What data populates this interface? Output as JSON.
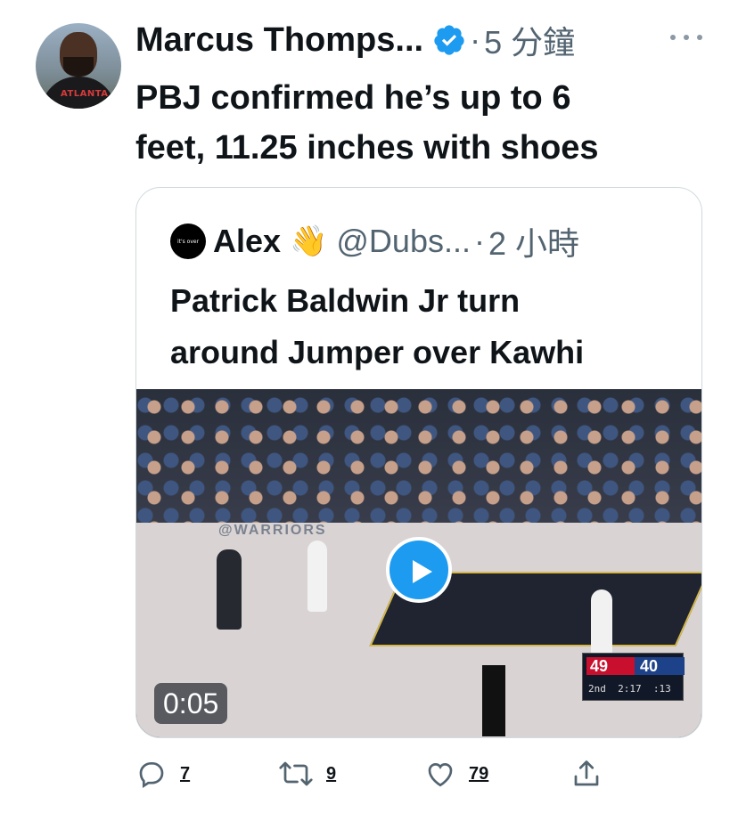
{
  "tweet": {
    "author_name": "Marcus Thomps...",
    "time": "5 分鐘",
    "separator": "·",
    "text_line1": "PBJ confirmed he’s up to 6",
    "text_line2": "feet, 11.25 inches with shoes",
    "avatar_shirt_text": "ATLANTA"
  },
  "quote": {
    "avatar_text": "it's over",
    "name": "Alex",
    "emoji": "👋",
    "handle": "@Dubs...",
    "separator": "·",
    "time": "2 小時",
    "text_line1": "Patrick Baldwin Jr turn",
    "text_line2": "around Jumper over Kawhi",
    "video": {
      "duration": "0:05",
      "scoreboard": {
        "left_score": "49",
        "right_score": "40",
        "quarter": "2nd",
        "clock": "2:17",
        "shot_clock": ":13"
      },
      "court_text": "@WARRIORS"
    }
  },
  "actions": {
    "reply_count": "7",
    "retweet_count": "9",
    "like_count": "79"
  },
  "colors": {
    "accent": "#1d9bf0",
    "muted": "#536471",
    "text": "#0f1419",
    "border": "#cfd9de"
  },
  "icons": [
    "verified-badge-icon",
    "more-icon",
    "reply-icon",
    "retweet-icon",
    "like-icon",
    "share-icon",
    "play-icon"
  ]
}
